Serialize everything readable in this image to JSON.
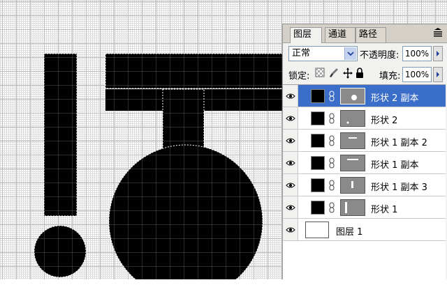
{
  "panel": {
    "tabs": [
      {
        "label": "图层",
        "close": "×"
      },
      {
        "label": "通道"
      },
      {
        "label": "路径"
      }
    ],
    "menu_icon": "panel-menu-icon",
    "close_icon": "close-icon"
  },
  "blend": {
    "mode": "正常",
    "opacity_label": "不透明度:",
    "opacity_value": "100%"
  },
  "lock": {
    "label": "锁定:",
    "icons": [
      "lock-transparent-icon",
      "lock-paint-icon",
      "lock-move-icon",
      "lock-all-icon"
    ],
    "fill_label": "填充:",
    "fill_value": "100%"
  },
  "layers": [
    {
      "name": "形状 2 副本",
      "selected": true,
      "thumb": "shape-vector-mask"
    },
    {
      "name": "形状 2",
      "selected": false,
      "thumb": "shape-vector-mask"
    },
    {
      "name": "形状 1 副本 2",
      "selected": false,
      "thumb": "shape-vector-mask"
    },
    {
      "name": "形状 1 副本",
      "selected": false,
      "thumb": "shape-vector-mask"
    },
    {
      "name": "形状 1 副本 3",
      "selected": false,
      "thumb": "shape-vector-mask"
    },
    {
      "name": "形状 1",
      "selected": false,
      "thumb": "shape-vector-mask"
    },
    {
      "name": "图层 1",
      "selected": false,
      "thumb": "white-pixel-layer"
    }
  ],
  "colors": {
    "selection": "#3b6ec8",
    "shape_fill": "#000000",
    "grid": "#bdbdbd"
  }
}
